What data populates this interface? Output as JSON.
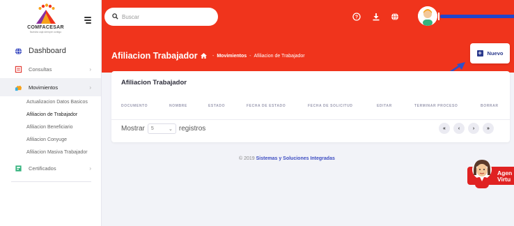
{
  "brand": {
    "name": "COMFACESAR",
    "tagline": "Nuestra caja siempre contigo"
  },
  "search": {
    "placeholder": "Buscar",
    "value": ""
  },
  "sidebar": {
    "items": [
      {
        "label": "Dashboard",
        "icon": "globe-icon"
      },
      {
        "label": "Consultas",
        "icon": "clipboard-icon"
      },
      {
        "label": "Movimientos",
        "icon": "hand-icon"
      },
      {
        "label": "Certificados",
        "icon": "certificate-icon"
      }
    ],
    "submenu": [
      "Actualizacion Datos Basicos",
      "Afiliacion de Trabajador",
      "Afiliacion Beneficiario",
      "Afiliacion Conyuge",
      "Afiliacion Masiva Trabajador"
    ]
  },
  "header": {
    "icons": [
      "help-icon",
      "download-icon",
      "globe-icon",
      "user-avatar"
    ]
  },
  "page": {
    "title": "Afiliacion Trabajador",
    "breadcrumb": [
      "Movimientos",
      "Afiliacion de Trabajador"
    ],
    "breadcrumb_sep": "-",
    "new_button": "Nuevo"
  },
  "card": {
    "title": "Afiliacion Trabajador",
    "columns": [
      "DOCUMENTO",
      "NOMBRE",
      "ESTADO",
      "FECHA DE ESTADO",
      "FECHA DE SOLICITUD",
      "EDITAR",
      "TERMINAR PROCESO",
      "BORRAR"
    ],
    "show_label": "Mostrar",
    "page_size": "5",
    "records_label": "registros",
    "pager": [
      "«",
      "‹",
      "›",
      "»"
    ]
  },
  "footer": {
    "prefix": "© 2019",
    "company": "Sistemas y Soluciones Integradas"
  },
  "agent": {
    "line1": "Agen",
    "line2": "Virtu"
  },
  "colors": {
    "primary": "#f0341c",
    "accent": "#2b3a8c",
    "link": "#3e4ec2",
    "agent": "#e02222"
  }
}
